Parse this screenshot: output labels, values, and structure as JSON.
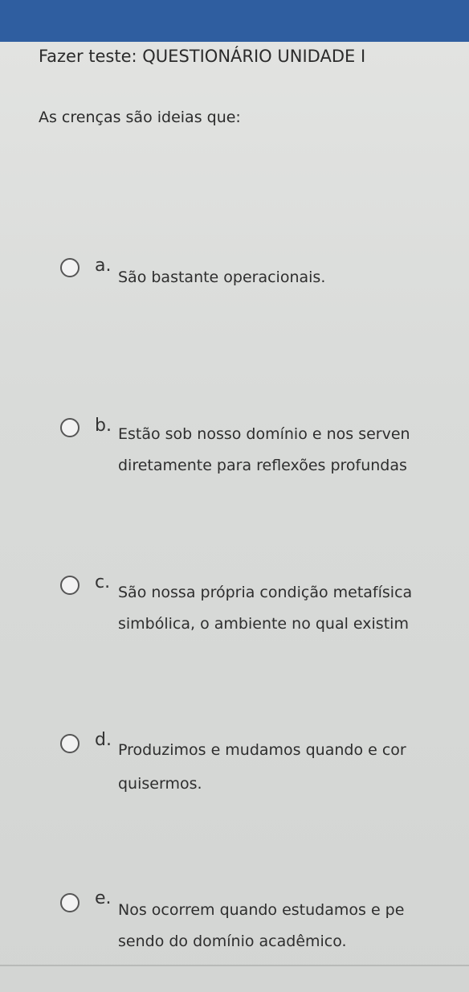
{
  "header": {
    "title": "Fazer teste: QUESTIONÁRIO UNIDADE I"
  },
  "question": {
    "text": "As crenças são ideias que:"
  },
  "options": [
    {
      "letter": "a.",
      "line1": "São bastante operacionais.",
      "line2": ""
    },
    {
      "letter": "b.",
      "line1": "Estão sob nosso domínio e nos serven",
      "line2": "diretamente para reflexões profundas"
    },
    {
      "letter": "c.",
      "line1": "São nossa própria condição metafísica",
      "line2": "simbólica, o ambiente no qual existim"
    },
    {
      "letter": "d.",
      "line1": "Produzimos e mudamos quando e cor",
      "line2": "quisermos."
    },
    {
      "letter": "e.",
      "line1": "Nos ocorrem quando estudamos e pe",
      "line2": "sendo do domínio acadêmico."
    }
  ]
}
